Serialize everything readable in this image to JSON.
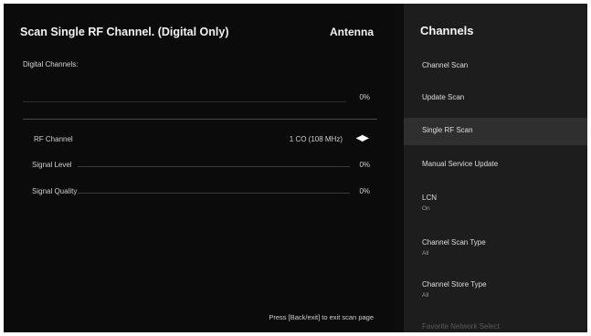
{
  "scan": {
    "title": "Scan Single RF Channel. (Digital Only)",
    "source": "Antenna",
    "digital_channels_label": "Digital Channels:",
    "progress_value": "0%",
    "rf_channel_label": "RF Channel",
    "rf_channel_value": "1 CO (108 MHz)",
    "rf_channel_arrows": "◀▶",
    "signal_level_label": "Signal Level",
    "signal_level_value": "0%",
    "signal_quality_label": "Signal Quality",
    "signal_quality_value": "0%",
    "footer_hint": "Press [Back/exit] to exit scan page"
  },
  "menu": {
    "title": "Channels",
    "items": [
      {
        "label": "Channel Scan",
        "sub": ""
      },
      {
        "label": "Update Scan",
        "sub": ""
      },
      {
        "label": "Single RF Scan",
        "sub": "",
        "selected": true
      },
      {
        "label": "Manual Service Update",
        "sub": ""
      },
      {
        "label": "LCN",
        "sub": "On"
      },
      {
        "label": "Channel Scan Type",
        "sub": "All"
      },
      {
        "label": "Channel Store Type",
        "sub": "All"
      },
      {
        "label": "Favorite Network Select",
        "sub": "",
        "faded": true
      }
    ]
  },
  "colors": {
    "background": "#0d0d0d",
    "menu_background": "#1d1d1d",
    "menu_selected": "#2f2f2f",
    "text": "#f2f2f2"
  }
}
